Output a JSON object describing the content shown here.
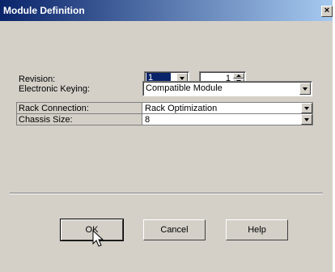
{
  "window": {
    "title": "Module Definition",
    "close_glyph": "×"
  },
  "fields": {
    "revision": {
      "label": "Revision:",
      "major": "1",
      "minor": "1"
    },
    "electronic_keying": {
      "label": "Electronic Keying:",
      "value": "Compatible Module"
    }
  },
  "grid": [
    {
      "label": "Rack Connection:",
      "value": "Rack Optimization"
    },
    {
      "label": "Chassis Size:",
      "value": "8"
    }
  ],
  "buttons": {
    "ok": "OK",
    "cancel": "Cancel",
    "help": "Help"
  }
}
